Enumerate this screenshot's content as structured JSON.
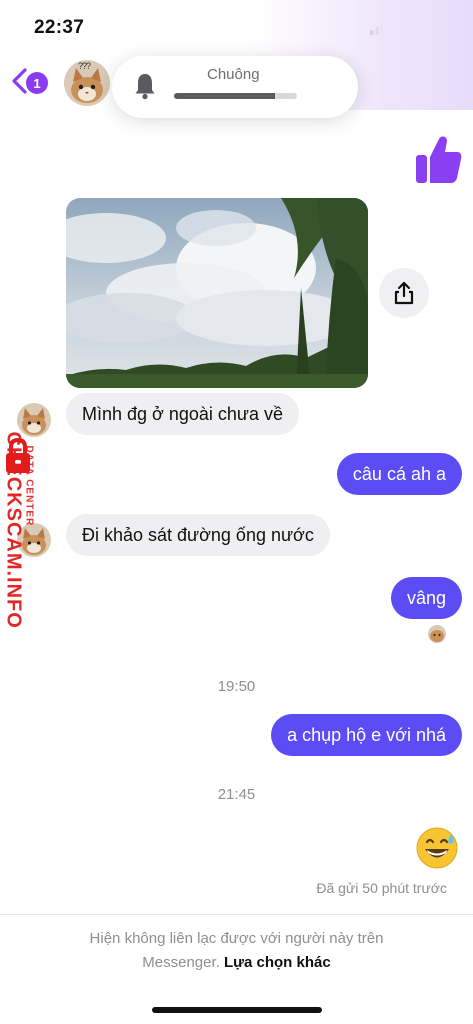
{
  "status_bar": {
    "time": "22:37"
  },
  "header": {
    "unread_count": "1",
    "contact_question_marks": "???"
  },
  "ringer": {
    "label": "Chuông",
    "level": 0.82
  },
  "messages": [
    {
      "from": "me",
      "kind": "reaction",
      "icon": "thumbs-up-icon"
    },
    {
      "from": "them",
      "kind": "photo",
      "description": "sky-clouds-trees"
    },
    {
      "from": "them",
      "text": "Mình đg ở ngoài chưa về"
    },
    {
      "from": "me",
      "text": "câu cá ah a"
    },
    {
      "from": "them",
      "text": "Đi khảo sát đường ống nước"
    },
    {
      "from": "me",
      "text": "vâng"
    },
    {
      "kind": "timestamp",
      "text": "19:50"
    },
    {
      "from": "me",
      "text": "a chụp hộ e với nhá"
    },
    {
      "kind": "timestamp",
      "text": "21:45"
    },
    {
      "from": "me",
      "kind": "emoji",
      "icon": "grinning-sweat-emoji"
    }
  ],
  "sent_status": "Đã gửi 50 phút trước",
  "footer": {
    "notice": "Hiện không liên lạc được với người này trên",
    "notice_line2": "Messenger.",
    "link": "Lựa chọn khác"
  },
  "watermark": {
    "main": "CHECKSCAM.INFO",
    "sub": "DATA CENTER"
  },
  "colors": {
    "accent": "#8b3cf0",
    "outgoing_bubble": "#5b4cf5",
    "incoming_bubble": "#efeff1",
    "watermark": "#e21c1c"
  }
}
